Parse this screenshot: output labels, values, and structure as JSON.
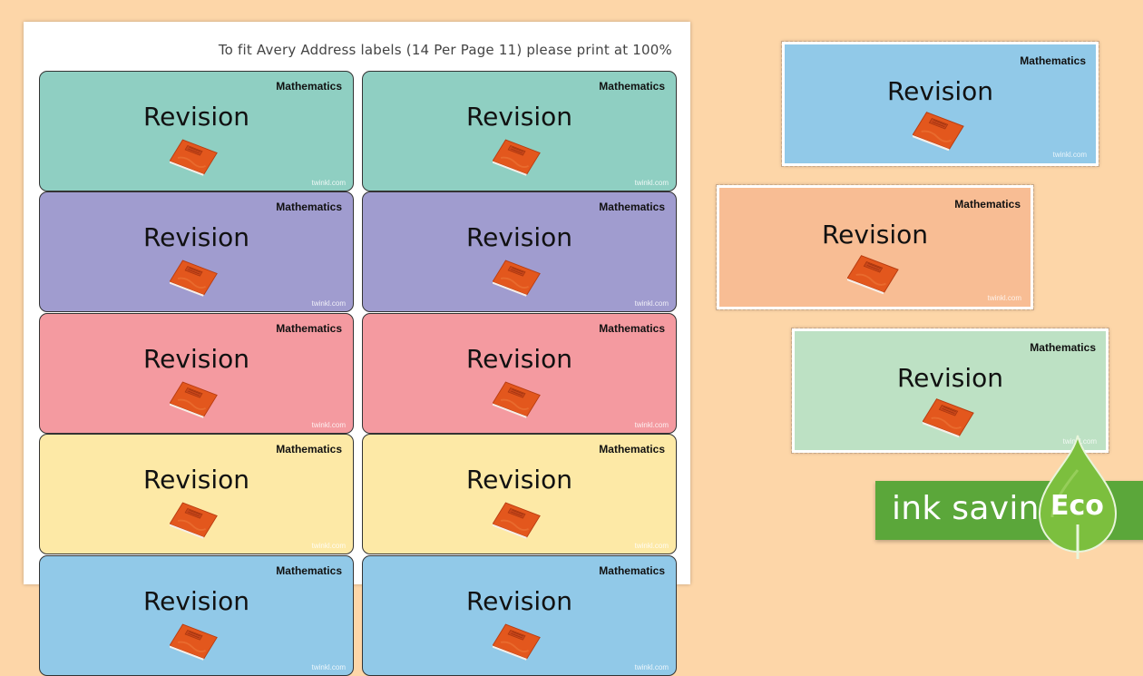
{
  "sheet": {
    "instructions": "To fit Avery Address labels (14 Per Page 11) please print at 100%"
  },
  "label_common": {
    "subject": "Mathematics",
    "title": "Revision",
    "watermark": "twinkl.com"
  },
  "colors": {
    "teal": "#8fcfc2",
    "lavender": "#a09ccf",
    "pink": "#f49aa0",
    "yellow": "#fde9a6",
    "blue": "#91c9e8",
    "peach": "#f8bd94",
    "mint": "#bde1c4",
    "background": "#fdd6a8",
    "book": "#e95d1e",
    "eco_green": "#5ba73a"
  },
  "grid_rows": [
    {
      "color": "teal"
    },
    {
      "color": "lavender"
    },
    {
      "color": "pink"
    },
    {
      "color": "yellow"
    },
    {
      "color": "blue"
    }
  ],
  "side_labels": [
    {
      "color": "blue"
    },
    {
      "color": "peach"
    },
    {
      "color": "mint"
    }
  ],
  "eco": {
    "banner_text": "ink saving",
    "badge_text": "Eco"
  },
  "icons": [
    "orange-exercise-book-icon",
    "eco-leaf-icon"
  ]
}
